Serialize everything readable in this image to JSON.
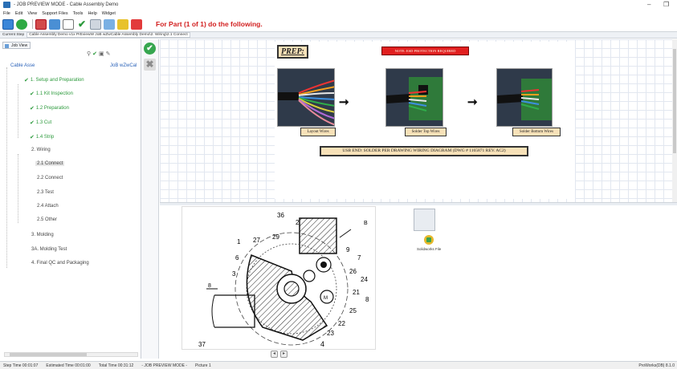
{
  "window": {
    "title": "- JOB PREVIEW MODE - Cable Assembly Demo",
    "minimize_glyph": "–",
    "restore_glyph": "❐"
  },
  "menu": [
    "File",
    "Edit",
    "View",
    "Support Files",
    "Tools",
    "Help",
    "Widget"
  ],
  "toolbar": {
    "part_message": "For Part (1 of 1) do the following."
  },
  "breadcrumb": {
    "label": "Current Step",
    "path": "Cable Assembly Demo v1x PrEviewW JoB wZwCable Assembly Demo\\2. Wiring\\2.1 Connect"
  },
  "left_panel": {
    "tab": "Job View",
    "root": "Cable Asse",
    "root_right": "JoB wZwCal",
    "items": [
      {
        "label": "1. Setup and Preparation",
        "done": true
      },
      {
        "label": "1.1 Kit Inspection",
        "done": true
      },
      {
        "label": "1.2 Preparation",
        "done": true
      },
      {
        "label": "1.3 Cut",
        "done": true
      },
      {
        "label": "1.4 Strip",
        "done": true
      },
      {
        "label": "2. Wiring",
        "done": false
      },
      {
        "label": "2.1 Connect",
        "done": false,
        "selected": true
      },
      {
        "label": "2.2 Connect",
        "done": false
      },
      {
        "label": "2.3 Test",
        "done": false
      },
      {
        "label": "2.4 Attach",
        "done": false
      },
      {
        "label": "2.5 Other",
        "done": false
      },
      {
        "label": "3. Molding",
        "done": false
      },
      {
        "label": "3A. Molding Test",
        "done": false
      },
      {
        "label": "4. Final QC and Packaging",
        "done": false
      }
    ]
  },
  "instruction": {
    "prep_title": "PREP:",
    "note": "NOTE: ESD PROTECTION REQUIRED",
    "captions": [
      "Layout Wires",
      "Solder Top Wires",
      "Solder Bottom Wires"
    ],
    "usb_end": "USB END:  SOLDER PER DRAWING WIRING DIAGRAM (DWG # 1165871 REV. AC2)"
  },
  "drawing_labels": [
    "36",
    "2",
    "B",
    "1",
    "27",
    "29",
    "9",
    "7",
    "6",
    "3",
    "26",
    "24",
    "21",
    "8",
    "8",
    "M",
    "25",
    "22",
    "23",
    "37",
    "4"
  ],
  "attachments": {
    "file_label": "Solidworks File"
  },
  "status": {
    "step_time": "Step Time 00:01:07",
    "estimated": "Estimated Time 00:01:00",
    "total": "Total Time 00:31:12",
    "mode": "- JOB PREVIEW MODE -",
    "picture": "Picture 1",
    "right": "ProWorks(DB) 8.1.0"
  }
}
